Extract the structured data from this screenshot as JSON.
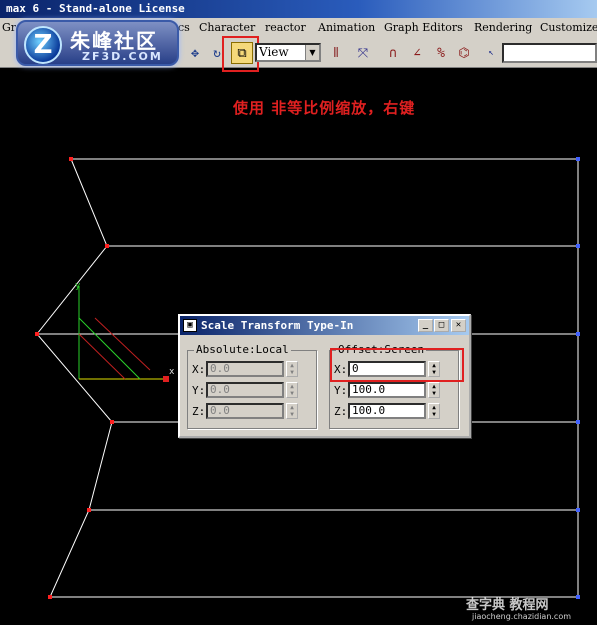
{
  "window": {
    "title": "max 6 - Stand-alone License"
  },
  "menubar": {
    "items": [
      {
        "label": "Gro"
      },
      {
        "label": "cs"
      },
      {
        "label": "Character"
      },
      {
        "label": "reactor"
      },
      {
        "label": "Animation"
      },
      {
        "label": "Graph Editors"
      },
      {
        "label": "Rendering"
      },
      {
        "label": "Customize"
      }
    ]
  },
  "toolbar": {
    "view_dropdown": "View",
    "buttons": [
      "select-and-move-icon",
      "select-and-rotate-icon",
      "select-and-scale-icon",
      "mirror-icon",
      "align-icon",
      "snap-3d-icon",
      "angle-snap-icon",
      "percent-snap-icon",
      "spinner-snap-icon",
      "named-selection-icon"
    ]
  },
  "logo": {
    "title": "朱峰社区",
    "subtitle": "ZF3D.COM",
    "badge": "Z"
  },
  "viewport": {
    "annotation": "使用 非等比例缩放，右键",
    "axis_x": "x",
    "axis_y": "y"
  },
  "dialog": {
    "title": "Scale Transform Type-In",
    "absolute": {
      "label": "Absolute:Local",
      "x_label": "X:",
      "x_value": "0.0",
      "y_label": "Y:",
      "y_value": "0.0",
      "z_label": "Z:",
      "z_value": "0.0"
    },
    "offset": {
      "label": "Offset:Screen",
      "x_label": "X:",
      "x_value": "0",
      "y_label": "Y:",
      "y_value": "100.0",
      "z_label": "Z:",
      "z_value": "100.0"
    }
  },
  "watermark": {
    "text": "查字典 教程网",
    "url": "jiaocheng.chazidian.com"
  },
  "colors": {
    "annotation": "#e02020",
    "wire": "#ffffff",
    "vertex": "#ff2020",
    "vertex_right": "#4060ff"
  }
}
